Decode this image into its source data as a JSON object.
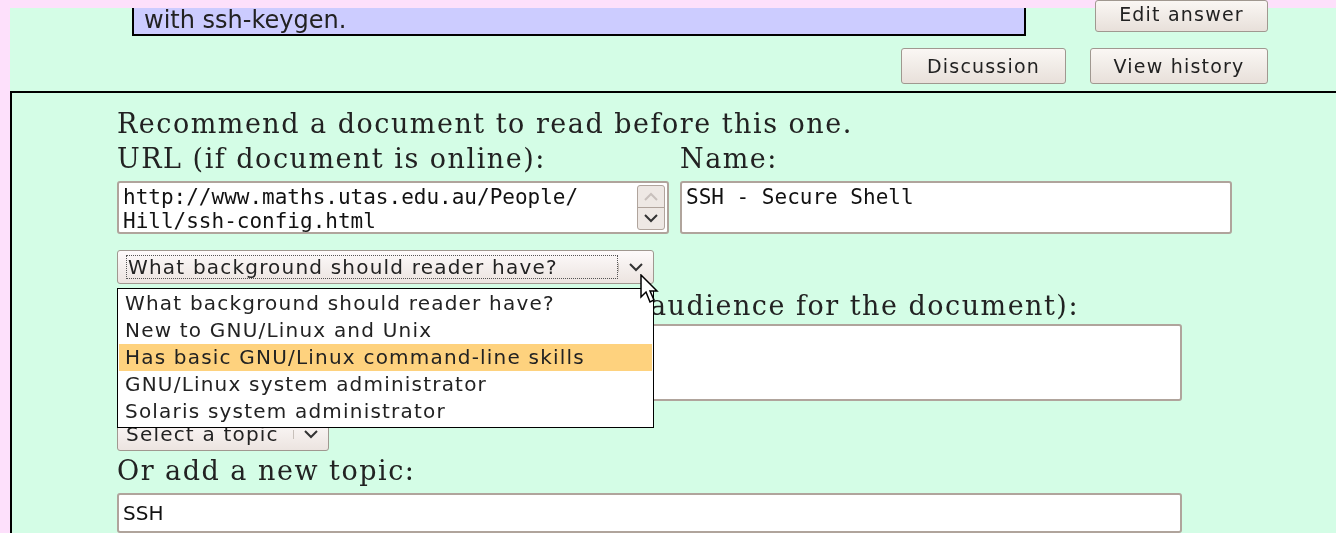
{
  "top_note": {
    "text": "with ssh-keygen."
  },
  "buttons": [
    {
      "label": "Edit answer"
    },
    {
      "label": "Discussion"
    },
    {
      "label": "View history"
    }
  ],
  "form": {
    "heading": "Recommend a document to read before this one.",
    "url_label": "URL (if document is online):",
    "url_value": "http://www.maths.utas.edu.au/People/Hill/ssh-config.html",
    "name_label": "Name:",
    "name_value": "SSH - Secure Shell",
    "background_select": {
      "value": "What background should reader have?",
      "expanded": true,
      "options": [
        {
          "label": "What background should reader have?",
          "highlighted": false
        },
        {
          "label": "New to GNU/Linux and Unix",
          "highlighted": false
        },
        {
          "label": "Has basic GNU/Linux command-line skills",
          "highlighted": true
        },
        {
          "label": "GNU/Linux system administrator",
          "highlighted": false
        },
        {
          "label": "Solaris system administrator",
          "highlighted": false
        }
      ]
    },
    "audience_label": "audience for the document):",
    "topic_select": {
      "value": "Select a topic"
    },
    "new_topic_label": "Or add a new topic:",
    "new_topic_value": "SSH"
  }
}
